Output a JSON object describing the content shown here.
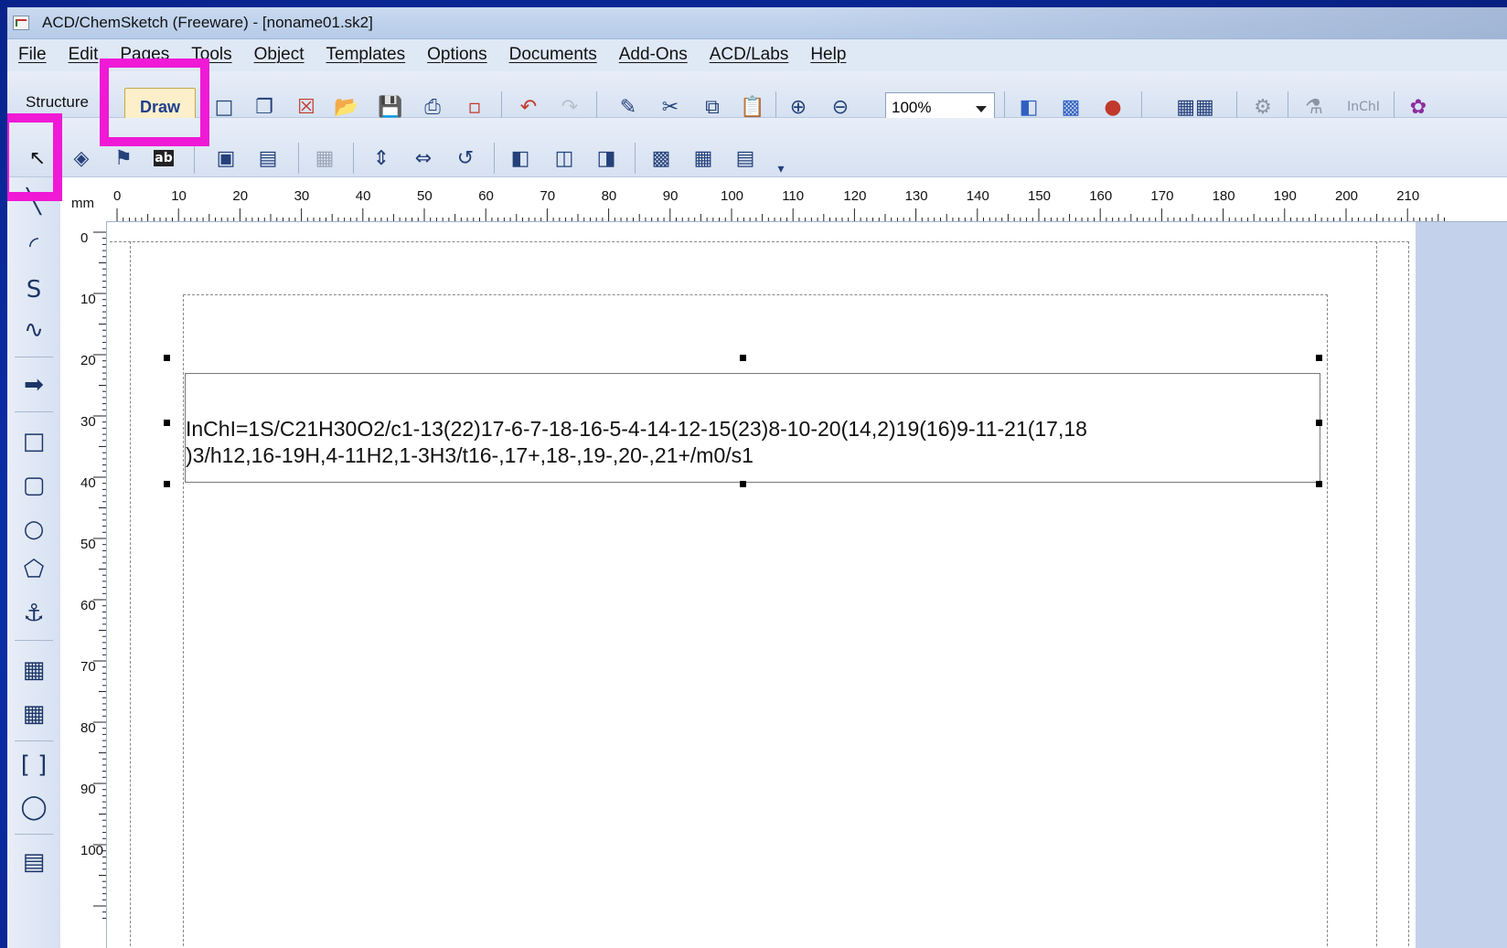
{
  "window": {
    "title": "ACD/ChemSketch (Freeware) - [noname01.sk2]"
  },
  "menu": [
    "File",
    "Edit",
    "Pages",
    "Tools",
    "Object",
    "Templates",
    "Options",
    "Documents",
    "Add-Ons",
    "ACD/Labs",
    "Help"
  ],
  "toolbar": {
    "structure_label": "Structure",
    "draw_label": "Draw",
    "zoom_value": "100%",
    "inchi_label": "InChI"
  },
  "ruler": {
    "unit": "mm",
    "h_ticks": [
      "0",
      "10",
      "20",
      "30",
      "40",
      "50",
      "60",
      "70",
      "80",
      "90",
      "100",
      "110",
      "120",
      "130",
      "140",
      "150",
      "160",
      "170",
      "180",
      "190",
      "200",
      "210"
    ],
    "v_ticks": [
      "0",
      "10",
      "20",
      "30",
      "40",
      "50",
      "60",
      "70",
      "80",
      "90",
      "100"
    ]
  },
  "canvas": {
    "inchi_line1": "InChI=1S/C21H30O2/c1-13(22)17-6-7-18-16-5-4-14-12-15(23)8-10-20(14,2)19(16)9-11-21(17,18",
    "inchi_line2": ")3/h12,16-19H,4-11H2,1-3H3/t16-,17+,18-,19-,20-,21+/m0/s1"
  },
  "highlight_color": "#ef19d6"
}
